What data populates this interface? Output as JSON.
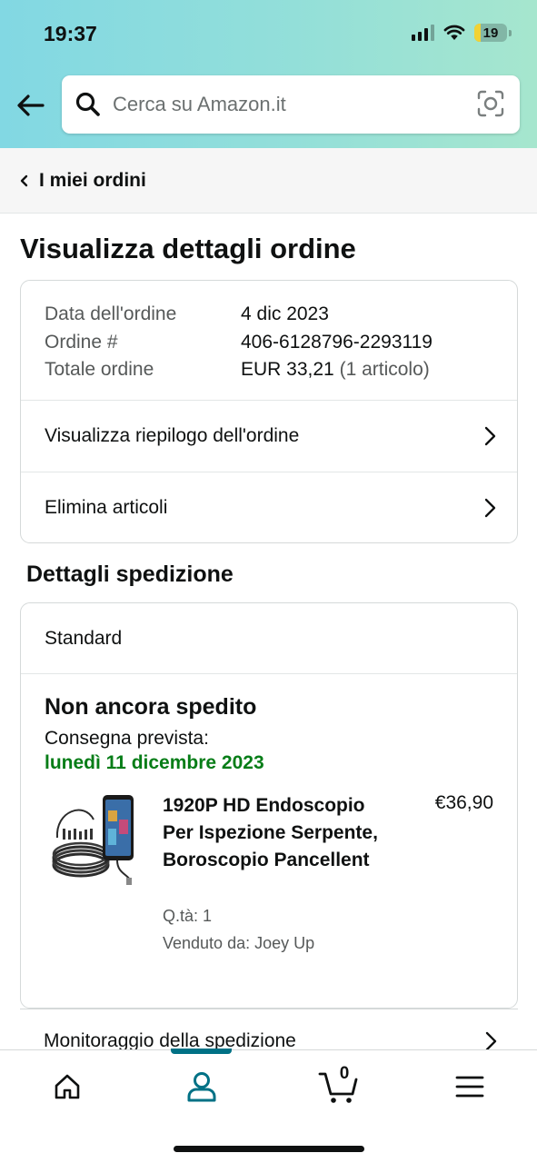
{
  "status_bar": {
    "time": "19:37",
    "battery": "19"
  },
  "header": {
    "back_icon": "arrow-left-icon",
    "search_placeholder": "Cerca su Amazon.it",
    "search_icon": "search-icon",
    "camera_icon": "camera-scan-icon",
    "gradient_colors": [
      "#82d8e3",
      "#a6e6ce"
    ]
  },
  "breadcrumb": {
    "label": "I miei ordini"
  },
  "page_title": "Visualizza dettagli ordine",
  "order_info": {
    "rows": [
      {
        "key": "Data dell'ordine",
        "value": "4 dic 2023"
      },
      {
        "key": "Ordine #",
        "value": "406-6128796-2293119"
      },
      {
        "key": "Totale ordine",
        "value": "EUR 33,21",
        "extra": "(1 articolo)"
      }
    ],
    "links": [
      {
        "label": "Visualizza riepilogo dell'ordine"
      },
      {
        "label": "Elimina articoli"
      }
    ]
  },
  "shipping": {
    "section_title": "Dettagli spedizione",
    "type": "Standard",
    "status": "Non ancora spedito",
    "delivery_label": "Consegna prevista:",
    "delivery_date": "lunedì 11 dicembre 2023",
    "delivery_color": "#067d17",
    "item": {
      "title": "1920P HD Endoscopio Per Ispezione Serpente, Boroscopio Pancellent",
      "price": "€36,90",
      "qty": "Q.tà: 1",
      "seller": "Venduto da: Joey Up"
    },
    "tracking_label": "Monitoraggio della spedizione"
  },
  "bottom_nav": {
    "items": [
      "home-icon",
      "account-icon",
      "cart-icon",
      "menu-icon"
    ],
    "active": "account-icon",
    "cart_count": "0",
    "accent": "#007185"
  }
}
